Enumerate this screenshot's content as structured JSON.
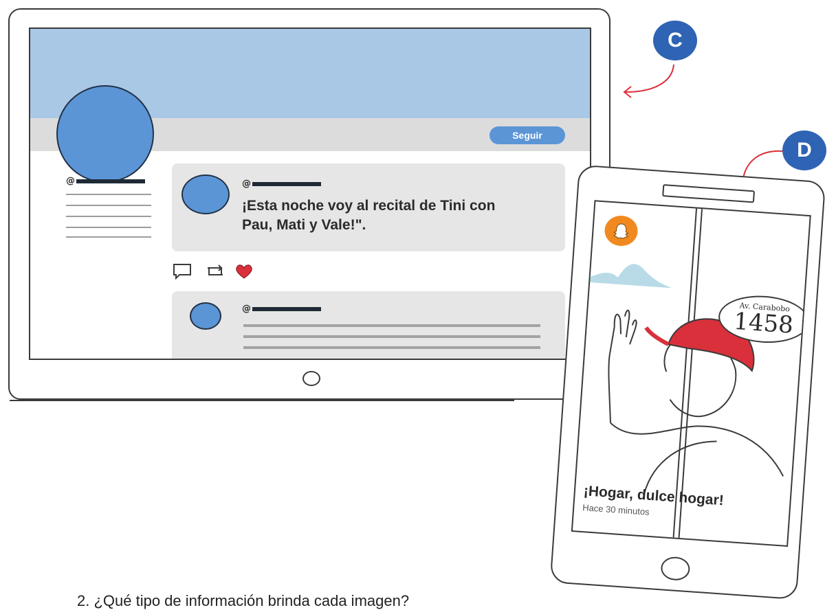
{
  "labels": {
    "c": "C",
    "d": "D"
  },
  "colors": {
    "label_blue": "#2f63b3",
    "avatar_blue": "#5b95d6",
    "cover_blue": "#a9c8e6",
    "heart_red": "#d9303b",
    "cap_red": "#d9303b",
    "story_orange": "#f08a20"
  },
  "tablet_profile": {
    "follow_label": "Seguir",
    "side_handle_prefix": "@",
    "post": {
      "handle_prefix": "@",
      "text_line1": "¡Esta noche voy al recital de Tini con",
      "text_line2": "Pau, Mati y Vale!\"."
    },
    "action_icons": [
      "comment-icon",
      "retweet-icon",
      "heart-icon"
    ],
    "post2": {
      "handle_prefix": "@"
    }
  },
  "phone_story": {
    "icon": "snapchat-ghost-icon",
    "address_street": "Av. Carabobo",
    "address_number": "1458",
    "caption": "¡Hogar, dulce hogar!",
    "time": "Hace 30 minutos"
  },
  "question": "2.  ¿Qué tipo de información brinda cada imagen?"
}
